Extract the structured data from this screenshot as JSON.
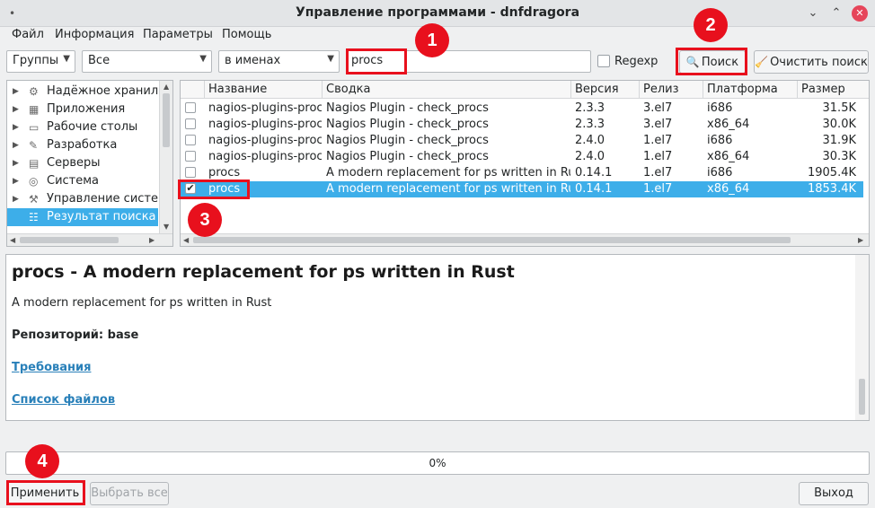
{
  "window": {
    "title": "Управление программами - dnfdragora",
    "controls": {
      "minimize": "⌄",
      "maximize": "⌃",
      "close": "✕"
    }
  },
  "menu": [
    "Файл",
    "Информация",
    "Параметры",
    "Помощь"
  ],
  "toolbar": {
    "group_combo": "Группы",
    "filter_combo": "Все",
    "field_combo": "в именах",
    "search_value": "procs",
    "regexp_label": "Regexp",
    "search_button": "Поиск",
    "clear_button": "Очистить поиск"
  },
  "groups": [
    {
      "label": "Надёжное хранилище",
      "icon": "storage-icon",
      "selected": false
    },
    {
      "label": "Приложения",
      "icon": "apps-icon",
      "selected": false
    },
    {
      "label": "Рабочие столы",
      "icon": "desktop-icon",
      "selected": false
    },
    {
      "label": "Разработка",
      "icon": "dev-icon",
      "selected": false
    },
    {
      "label": "Серверы",
      "icon": "server-icon",
      "selected": false
    },
    {
      "label": "Система",
      "icon": "system-icon",
      "selected": false
    },
    {
      "label": "Управление системой",
      "icon": "admin-icon",
      "selected": false
    },
    {
      "label": "Результат поиска",
      "icon": "search-result-icon",
      "selected": true
    }
  ],
  "table": {
    "columns": [
      "Название",
      "Сводка",
      "Версия",
      "Релиз",
      "Платформа",
      "Размер"
    ],
    "rows": [
      {
        "checked": false,
        "name": "nagios-plugins-procs",
        "summary": "Nagios Plugin - check_procs",
        "version": "2.3.3",
        "release": "3.el7",
        "arch": "i686",
        "size": "31.5K",
        "selected": false
      },
      {
        "checked": false,
        "name": "nagios-plugins-procs",
        "summary": "Nagios Plugin - check_procs",
        "version": "2.3.3",
        "release": "3.el7",
        "arch": "x86_64",
        "size": "30.0K",
        "selected": false
      },
      {
        "checked": false,
        "name": "nagios-plugins-procs",
        "summary": "Nagios Plugin - check_procs",
        "version": "2.4.0",
        "release": "1.el7",
        "arch": "i686",
        "size": "31.9K",
        "selected": false
      },
      {
        "checked": false,
        "name": "nagios-plugins-procs",
        "summary": "Nagios Plugin - check_procs",
        "version": "2.4.0",
        "release": "1.el7",
        "arch": "x86_64",
        "size": "30.3K",
        "selected": false
      },
      {
        "checked": false,
        "name": "procs",
        "summary": "A modern replacement for ps written in Rust",
        "version": "0.14.1",
        "release": "1.el7",
        "arch": "i686",
        "size": "1905.4K",
        "selected": false
      },
      {
        "checked": true,
        "name": "procs",
        "summary": "A modern replacement for ps written in Rust",
        "version": "0.14.1",
        "release": "1.el7",
        "arch": "x86_64",
        "size": "1853.4K",
        "selected": true
      }
    ]
  },
  "details": {
    "title": "procs - A modern replacement for ps written in Rust",
    "summary": "A modern replacement for ps written in Rust",
    "repository": "Репозиторий: base",
    "requirements_link": "Требования",
    "files_link": "Список файлов"
  },
  "progress": {
    "label": "0%",
    "value": 0
  },
  "bottom": {
    "apply_button": "Применить",
    "select_all_button": "Выбрать все",
    "exit_button": "Выход"
  },
  "annotations": [
    "1",
    "2",
    "3",
    "4"
  ],
  "colors": {
    "accent": "#3daee9",
    "annotation": "#e8101d",
    "link": "#2980b9"
  }
}
